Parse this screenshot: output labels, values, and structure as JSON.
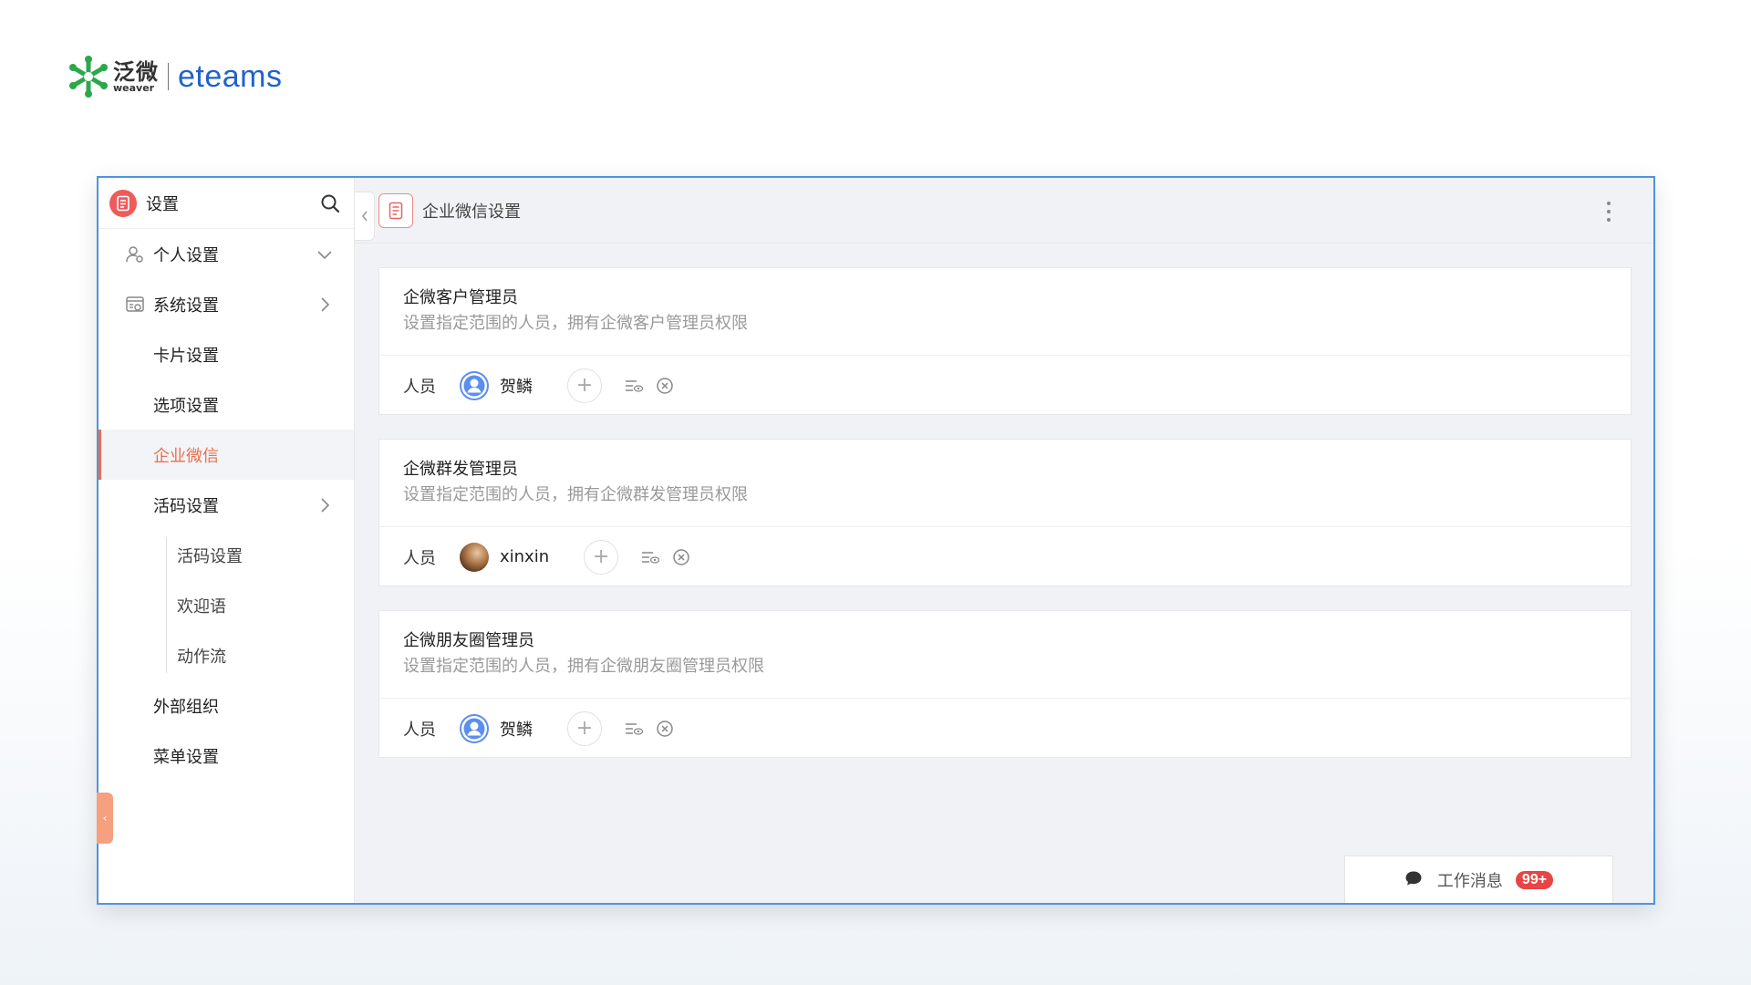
{
  "logo": {
    "cn": "泛微",
    "en": "weaver",
    "brand": "eteams"
  },
  "sidebar": {
    "title": "设置",
    "items": [
      {
        "label": "个人设置"
      },
      {
        "label": "系统设置"
      },
      {
        "label": "卡片设置"
      },
      {
        "label": "选项设置"
      },
      {
        "label": "企业微信"
      },
      {
        "label": "活码设置"
      },
      {
        "label": "活码设置"
      },
      {
        "label": "欢迎语"
      },
      {
        "label": "动作流"
      },
      {
        "label": "外部组织"
      },
      {
        "label": "菜单设置"
      }
    ]
  },
  "main": {
    "title": "企业微信设置",
    "cards": [
      {
        "title": "企微客户管理员",
        "desc": "设置指定范围的人员，拥有企微客户管理员权限",
        "row_label": "人员",
        "user": "贺鳞"
      },
      {
        "title": "企微群发管理员",
        "desc": "设置指定范围的人员，拥有企微群发管理员权限",
        "row_label": "人员",
        "user": "xinxin"
      },
      {
        "title": "企微朋友圈管理员",
        "desc": "设置指定范围的人员，拥有企微朋友圈管理员权限",
        "row_label": "人员",
        "user": "贺鳞"
      }
    ],
    "add_symbol": "+"
  },
  "messages": {
    "label": "工作消息",
    "count": "99+"
  },
  "colors": {
    "accent": "#e8704d",
    "window_border": "#4d94e0",
    "badge": "#e84545",
    "brand": "#1f63c9"
  }
}
